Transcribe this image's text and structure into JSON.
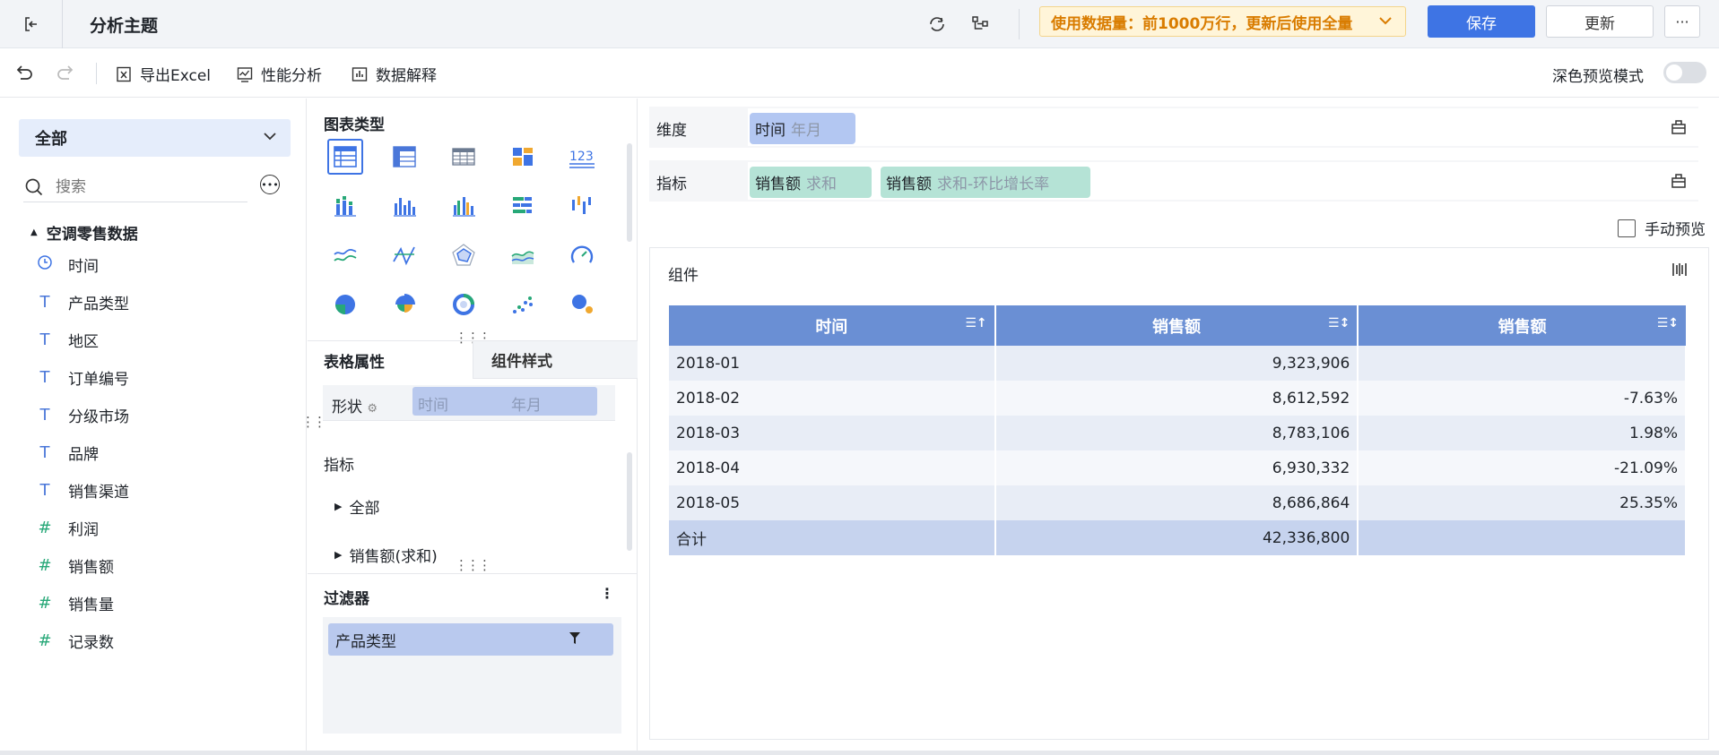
{
  "header": {
    "title": "分析主题",
    "usage_notice": "使用数据量：前1000万行，更新后使用全量",
    "save_label": "保存",
    "update_label": "更新",
    "more_label": "···"
  },
  "toolbar": {
    "export_label": "导出Excel",
    "perf_label": "性能分析",
    "explain_label": "数据解释",
    "dark_mode_label": "深色预览模式"
  },
  "left_panel": {
    "selector_value": "全部",
    "search_placeholder": "搜索",
    "dataset_name": "空调零售数据",
    "fields": [
      {
        "name": "时间",
        "type": "time",
        "icon": "clock-icon"
      },
      {
        "name": "产品类型",
        "type": "text",
        "icon": "text-icon"
      },
      {
        "name": "地区",
        "type": "text",
        "icon": "text-icon"
      },
      {
        "name": "订单编号",
        "type": "text",
        "icon": "text-icon"
      },
      {
        "name": "分级市场",
        "type": "text",
        "icon": "text-icon"
      },
      {
        "name": "品牌",
        "type": "text",
        "icon": "text-icon"
      },
      {
        "name": "销售渠道",
        "type": "text",
        "icon": "text-icon"
      },
      {
        "name": "利润",
        "type": "number",
        "icon": "hash-icon"
      },
      {
        "name": "销售额",
        "type": "number",
        "icon": "hash-icon"
      },
      {
        "name": "销售量",
        "type": "number",
        "icon": "hash-icon"
      },
      {
        "name": "记录数",
        "type": "number",
        "icon": "hash-icon"
      }
    ]
  },
  "middle_panel": {
    "chart_types_title": "图表类型",
    "chart_types": [
      "table-grouped",
      "table-cross",
      "table-detail",
      "kpi-card",
      "number-card",
      "bar-grouped",
      "bar-stacked",
      "bar-multi",
      "bar-horizontal",
      "bar-range",
      "line",
      "radar-line",
      "radar",
      "area",
      "gauge",
      "pie",
      "pie-rose",
      "ring",
      "scatter",
      "bubble"
    ],
    "tab_table_props": "表格属性",
    "tab_component_style": "组件样式",
    "shape_label": "形状",
    "shape_field": "时间",
    "shape_field_sub": "年月",
    "indicators_label": "指标",
    "indicator_items": [
      "全部",
      "销售额(求和)"
    ],
    "filter_title": "过滤器",
    "filter_item": "产品类型"
  },
  "right_panel": {
    "dimension_label": "维度",
    "dimension_pill": {
      "name": "时间",
      "sub": "年月"
    },
    "indicator_label": "指标",
    "indicator_pills": [
      {
        "name": "销售额",
        "sub": "求和"
      },
      {
        "name": "销售额",
        "sub": "求和-环比增长率"
      }
    ],
    "manual_preview_label": "手动预览",
    "component_title": "组件",
    "table": {
      "headers": [
        "时间",
        "销售额",
        "销售额"
      ],
      "rows": [
        [
          "2018-01",
          "9,323,906",
          ""
        ],
        [
          "2018-02",
          "8,612,592",
          "-7.63%"
        ],
        [
          "2018-03",
          "8,783,106",
          "1.98%"
        ],
        [
          "2018-04",
          "6,930,332",
          "-21.09%"
        ],
        [
          "2018-05",
          "8,686,864",
          "25.35%"
        ]
      ],
      "total": [
        "合计",
        "42,336,800",
        ""
      ]
    }
  }
}
